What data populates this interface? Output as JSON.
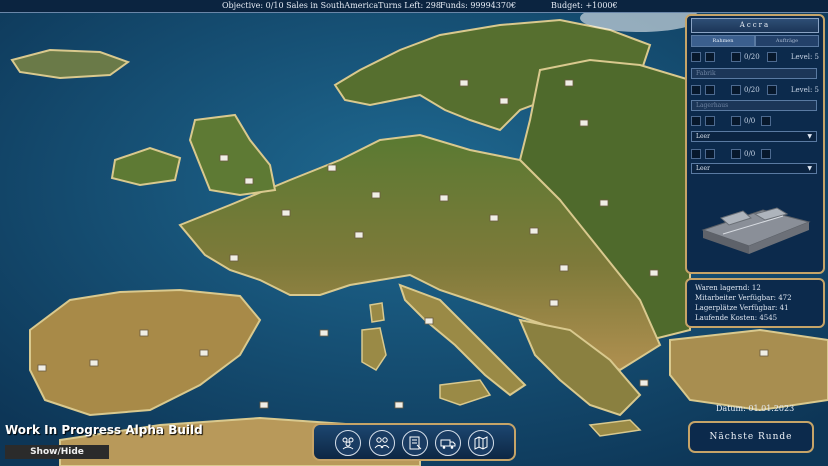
{
  "topbar": {
    "objective": "Objective:  0/10 Sales in SouthAmericaTurns Left: 298",
    "funds": "Funds: 99994370€",
    "budget": "Budget: +1000€"
  },
  "panel": {
    "city": "Accra",
    "tabs": [
      "Rahmen",
      "Aufträge"
    ],
    "slots": [
      {
        "count": "0/20",
        "level": "Level: 5",
        "type": "Fabrik",
        "active": false
      },
      {
        "count": "0/20",
        "level": "Level: 5",
        "type": "Lagerhaus",
        "active": false
      },
      {
        "count": "0/0",
        "level": "",
        "type": "Leer",
        "active": true
      },
      {
        "count": "0/0",
        "level": "",
        "type": "Leer",
        "active": true
      }
    ]
  },
  "stats": {
    "waren": "Waren lagernd: 12",
    "mitarbeiter": "Mitarbeiter Verfügbar: 472",
    "lager": "Lagerplätze Verfügbar: 41",
    "kosten": "Laufende Kosten: 4545"
  },
  "date": "Datum: 01.01.2023",
  "next_round": "Nächste Runde",
  "toolbar_icons": [
    "group-icon",
    "people-icon",
    "document-icon",
    "truck-icon",
    "map-icon"
  ],
  "wip": "Work In Progress Alpha Build",
  "show_hide": "Show/Hide",
  "colors": {
    "accent": "#c6a468",
    "panel": "#0c2a4c",
    "sea": "#1a5a82",
    "land": "#8a7a40"
  }
}
